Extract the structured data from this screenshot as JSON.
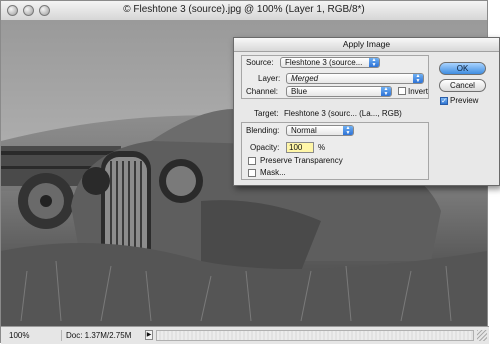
{
  "document": {
    "title": "© Fleshtone 3 (source).jpg @ 100% (Layer 1, RGB/8*)",
    "zoom": "100%",
    "doc_info": "Doc: 1.37M/2.75M"
  },
  "dialog": {
    "title": "Apply Image",
    "source_label": "Source:",
    "source_value": "Fleshtone 3 (source...",
    "layer_label": "Layer:",
    "layer_value": "Merged",
    "channel_label": "Channel:",
    "channel_value": "Blue",
    "invert_label": "Invert",
    "target_label": "Target:",
    "target_value": "Fleshtone 3 (sourc... (La..., RGB)",
    "blending_label": "Blending:",
    "blending_value": "Normal",
    "opacity_label": "Opacity:",
    "opacity_value": "100",
    "opacity_unit": "%",
    "preserve_label": "Preserve Transparency",
    "mask_label": "Mask...",
    "ok_label": "OK",
    "cancel_label": "Cancel",
    "preview_label": "Preview",
    "preview_checked": true,
    "invert_checked": false
  },
  "colors": {
    "default_button": "#3f8de0",
    "opacity_highlight": "#fff6a8"
  }
}
